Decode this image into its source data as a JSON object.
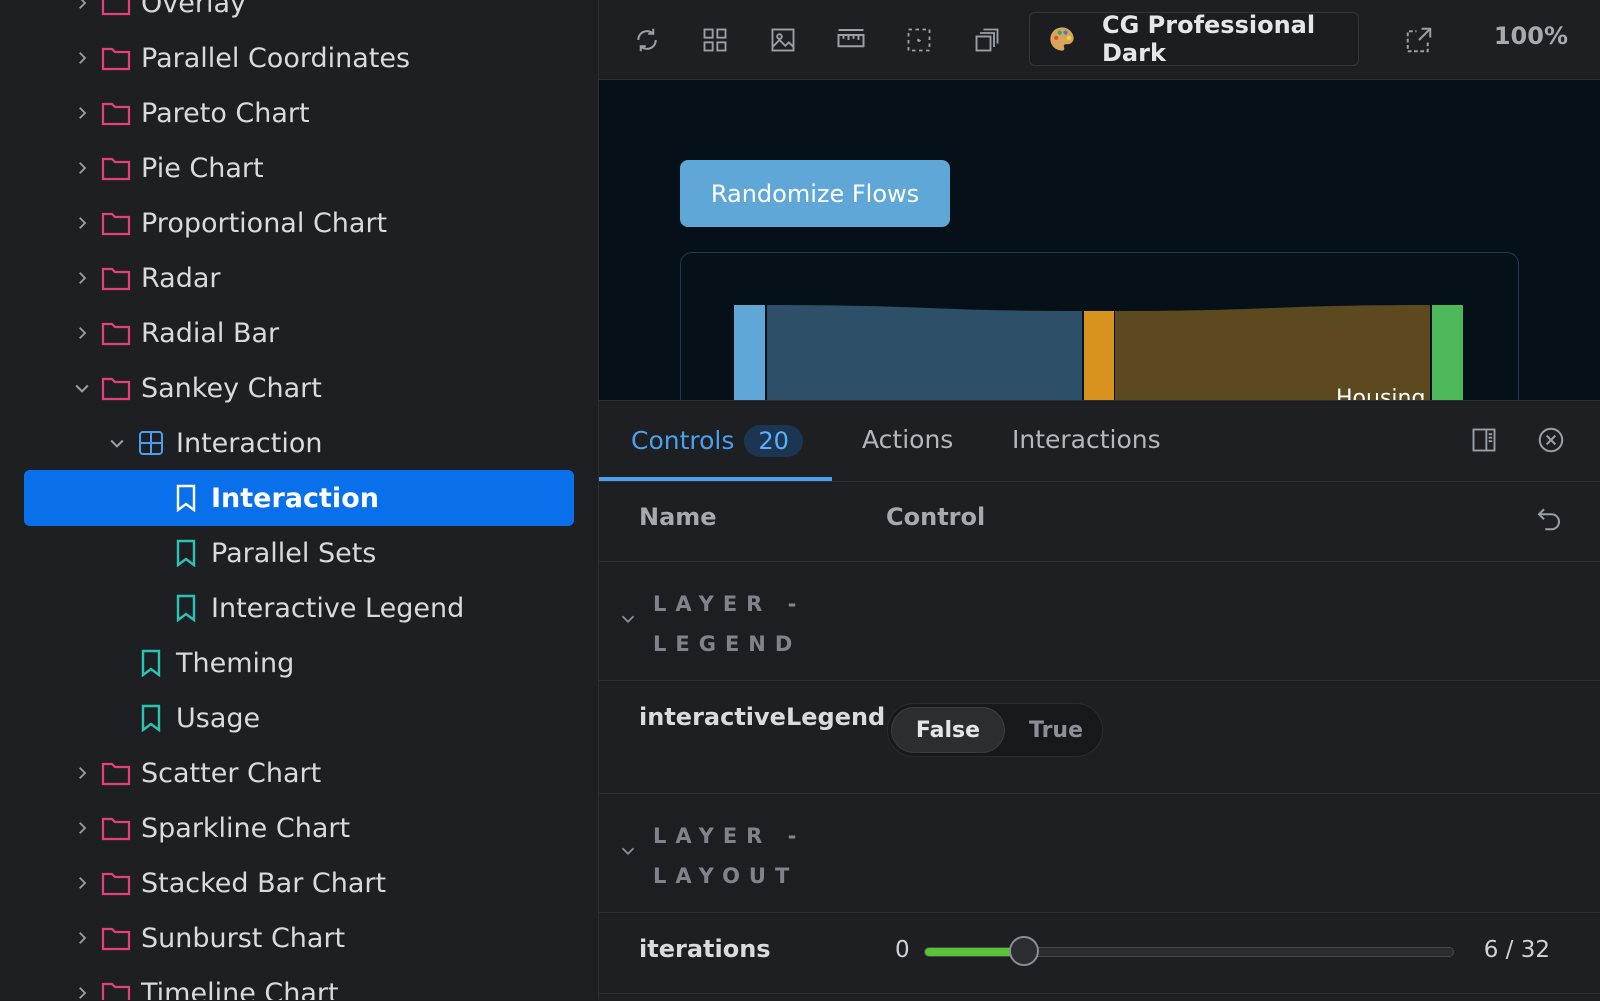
{
  "sidebar": {
    "items": [
      {
        "label": "Overlay",
        "type": "folder",
        "depth": 0,
        "expanded": false
      },
      {
        "label": "Parallel Coordinates",
        "type": "folder",
        "depth": 0,
        "expanded": false
      },
      {
        "label": "Pareto Chart",
        "type": "folder",
        "depth": 0,
        "expanded": false
      },
      {
        "label": "Pie Chart",
        "type": "folder",
        "depth": 0,
        "expanded": false
      },
      {
        "label": "Proportional Chart",
        "type": "folder",
        "depth": 0,
        "expanded": false
      },
      {
        "label": "Radar",
        "type": "folder",
        "depth": 0,
        "expanded": false
      },
      {
        "label": "Radial Bar",
        "type": "folder",
        "depth": 0,
        "expanded": false
      },
      {
        "label": "Sankey Chart",
        "type": "folder",
        "depth": 0,
        "expanded": true
      },
      {
        "label": "Interaction",
        "type": "component",
        "depth": 1,
        "expanded": true
      },
      {
        "label": "Interaction",
        "type": "story",
        "depth": 2,
        "selected": true
      },
      {
        "label": "Parallel Sets",
        "type": "story",
        "depth": 2
      },
      {
        "label": "Interactive Legend",
        "type": "story",
        "depth": 2
      },
      {
        "label": "Theming",
        "type": "story",
        "depth": 1
      },
      {
        "label": "Usage",
        "type": "story",
        "depth": 1
      },
      {
        "label": "Scatter Chart",
        "type": "folder",
        "depth": 0,
        "expanded": false
      },
      {
        "label": "Sparkline Chart",
        "type": "folder",
        "depth": 0,
        "expanded": false
      },
      {
        "label": "Stacked Bar Chart",
        "type": "folder",
        "depth": 0,
        "expanded": false
      },
      {
        "label": "Sunburst Chart",
        "type": "folder",
        "depth": 0,
        "expanded": false
      },
      {
        "label": "Timeline Chart",
        "type": "folder",
        "depth": 0,
        "expanded": false
      }
    ]
  },
  "toolbar": {
    "icons": [
      "reload-icon",
      "grid-icon",
      "image-icon",
      "ruler-icon",
      "outline-icon",
      "layers-icon"
    ],
    "theme_label": "CG Professional Dark",
    "theme_icon": "palette-icon",
    "zoom": "100%"
  },
  "preview": {
    "randomize_label": "Randomize Flows",
    "node_label": "Housing"
  },
  "addons": {
    "tabs": [
      {
        "label": "Controls",
        "badge": "20",
        "active": true
      },
      {
        "label": "Actions"
      },
      {
        "label": "Interactions"
      }
    ],
    "table": {
      "col_name": "Name",
      "col_control": "Control"
    },
    "sections": [
      {
        "title": "LAYER - LEGEND"
      },
      {
        "title": "LAYER - LAYOUT"
      }
    ],
    "interactiveLegend": {
      "name": "interactiveLegend",
      "false_label": "False",
      "true_label": "True",
      "value": false
    },
    "iterations": {
      "name": "iterations",
      "min_label": "0",
      "value": 6,
      "max": 32,
      "readout": "6 / 32"
    }
  },
  "colors": {
    "accent": "#0a6fea",
    "folder": "#e4407d",
    "story": "#2bc4b4",
    "component": "#4aa0f0",
    "node_blue": "#5ea7d6",
    "node_orange": "#d8921e",
    "node_green": "#4cb85a"
  }
}
